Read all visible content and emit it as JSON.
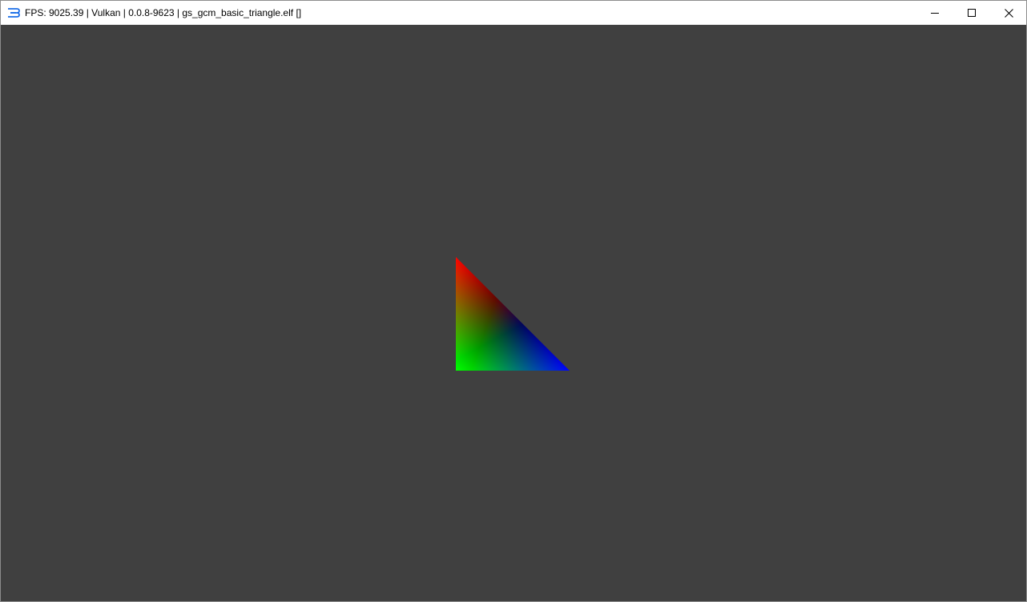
{
  "window": {
    "title": "FPS: 9025.39 | Vulkan | 0.0.8-9623 | gs_gcm_basic_triangle.elf []",
    "app_icon": "rpcs3-logo-icon",
    "controls": {
      "minimize_icon": "minimize-icon",
      "maximize_icon": "maximize-icon",
      "close_icon": "close-icon"
    }
  },
  "viewport": {
    "background": "#404040",
    "triangle": {
      "vertex_colors": {
        "top": "#ff0000",
        "bottom_left": "#00ff00",
        "bottom_right": "#0000ff"
      }
    }
  }
}
